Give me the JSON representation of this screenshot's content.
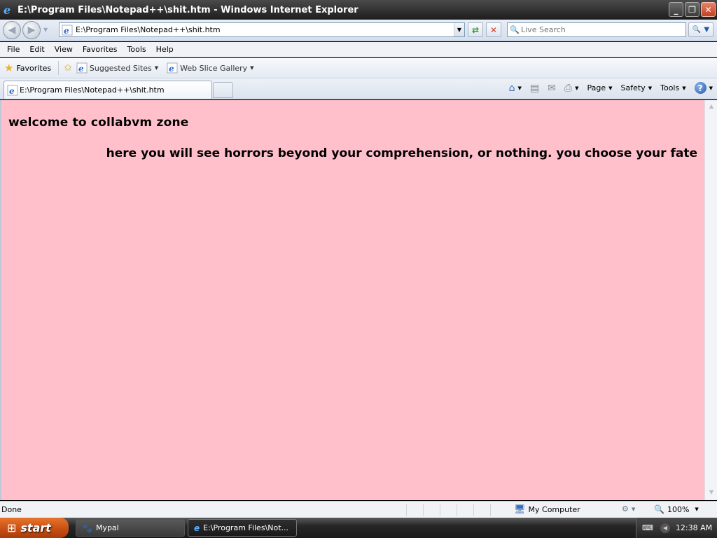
{
  "window": {
    "title": "E:\\Program Files\\Notepad++\\shit.htm - Windows Internet Explorer",
    "minimize": "_",
    "restore": "❐",
    "close": "✕"
  },
  "address": {
    "url": "E:\\Program Files\\Notepad++\\shit.htm"
  },
  "search": {
    "placeholder": "Live Search"
  },
  "menu": {
    "items": [
      "File",
      "Edit",
      "View",
      "Favorites",
      "Tools",
      "Help"
    ]
  },
  "favorites": {
    "label": "Favorites",
    "links": [
      "Suggested Sites",
      "Web Slice Gallery"
    ]
  },
  "tab": {
    "label": "E:\\Program Files\\Notepad++\\shit.htm"
  },
  "commandbar": {
    "page": "Page",
    "safety": "Safety",
    "tools": "Tools"
  },
  "page": {
    "heading": "welcome to collabvm zone",
    "tagline": "here you will see horrors beyond your comprehension, or nothing. you choose your fate",
    "background_color": "#ffc0cb"
  },
  "status": {
    "text": "Done",
    "zone": "My Computer",
    "zoom": "100%"
  },
  "taskbar": {
    "start": "start",
    "items": [
      "Mypal",
      "E:\\Program Files\\Not..."
    ],
    "clock": "12:38 AM"
  }
}
